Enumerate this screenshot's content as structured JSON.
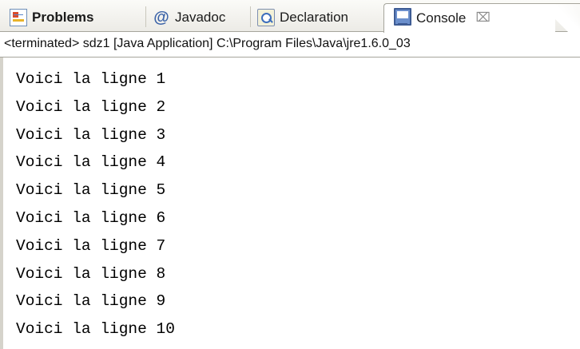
{
  "tabs": [
    {
      "label": "Problems",
      "icon": "problems-icon"
    },
    {
      "label": "Javadoc",
      "icon": "javadoc-icon"
    },
    {
      "label": "Declaration",
      "icon": "declaration-icon"
    },
    {
      "label": "Console",
      "icon": "console-icon",
      "close": "⌧",
      "active": true
    }
  ],
  "javadoc_icon_glyph": "@",
  "status_line": "<terminated> sdz1 [Java Application] C:\\Program Files\\Java\\jre1.6.0_03",
  "console_lines": [
    "Voici la ligne 1",
    "Voici la ligne 2",
    "Voici la ligne 3",
    "Voici la ligne 4",
    "Voici la ligne 5",
    "Voici la ligne 6",
    "Voici la ligne 7",
    "Voici la ligne 8",
    "Voici la ligne 9",
    "Voici la ligne 10"
  ],
  "colors": {
    "tabbar_background": "#ecebe6",
    "border": "#a6a59c",
    "console_text": "#000000"
  }
}
